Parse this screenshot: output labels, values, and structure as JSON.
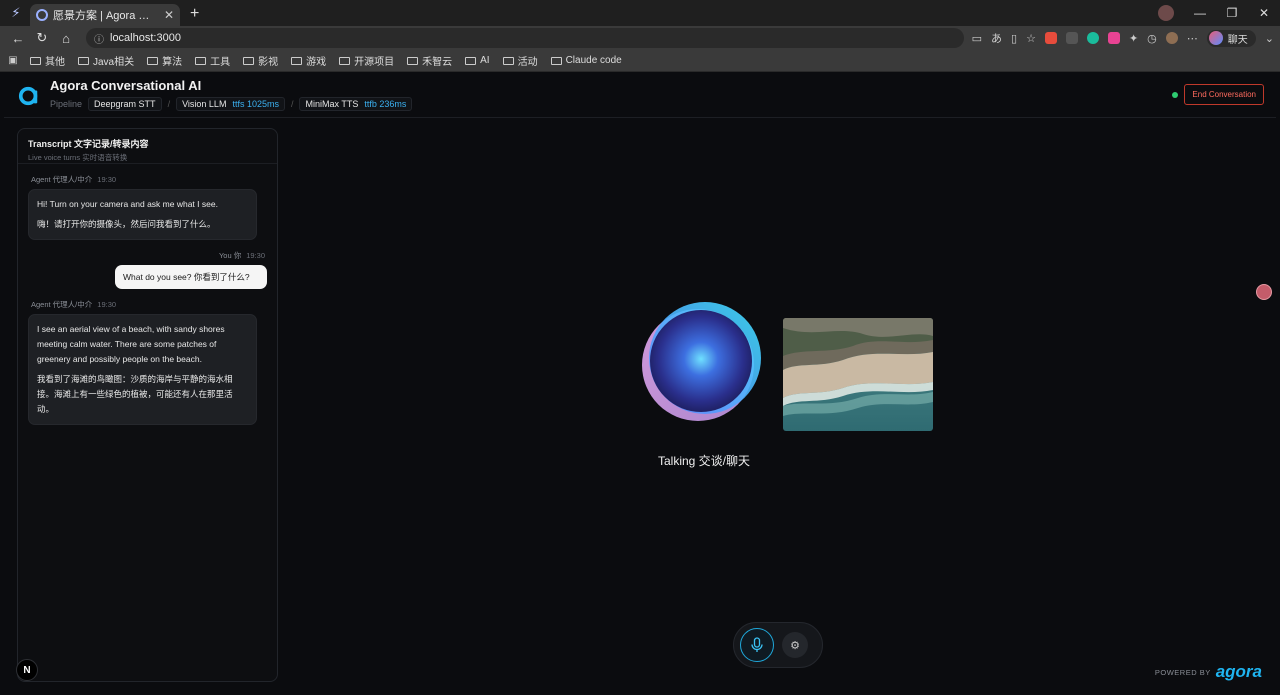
{
  "browser": {
    "tab_title": "愿景方案 | Agora 对话式人工智能",
    "url": "localhost:3000",
    "profile_label": "聊天",
    "bookmarks": [
      "其他",
      "Java相关",
      "算法",
      "工具",
      "影视",
      "游戏",
      "开源项目",
      "禾智云",
      "AI",
      "活动",
      "Claude code"
    ]
  },
  "app": {
    "title": "Agora Conversational AI",
    "pipeline_label": "Pipeline",
    "stt": "Deepgram STT",
    "llm": "Vision LLM",
    "llm_metric": "ttfs 1025ms",
    "tts": "MiniMax TTS",
    "tts_metric": "ttfb 236ms",
    "end_button": "End Conversation",
    "status_color": "#2ecc71",
    "accent_color": "#1fb4f0"
  },
  "transcript": {
    "title": "Transcript 文字记录/转录内容",
    "subtitle": "Live voice turns 实时语音转换",
    "messages": [
      {
        "role": "Agent 代理人/中介",
        "time": "19:30",
        "en": "Hi! Turn on your camera and ask me what I see.",
        "zh": "嗨！请打开你的摄像头，然后问我看到了什么。"
      },
      {
        "role": "You 你",
        "time": "19:30",
        "text": "What do you see? 你看到了什么?"
      },
      {
        "role": "Agent 代理人/中介",
        "time": "19:30",
        "en": "I see an aerial view of a beach, with sandy shores meeting calm water. There are some patches of greenery and possibly people on the beach.",
        "zh": "我看到了海滩的鸟瞰图：沙质的海岸与平静的海水相接。海滩上有一些绿色的植被，可能还有人在那里活动。"
      }
    ]
  },
  "stage": {
    "status": "Talking 交谈/聊天"
  },
  "footer": {
    "powered_by": "POWERED BY",
    "brand": "agora"
  },
  "dev_badge": "N"
}
